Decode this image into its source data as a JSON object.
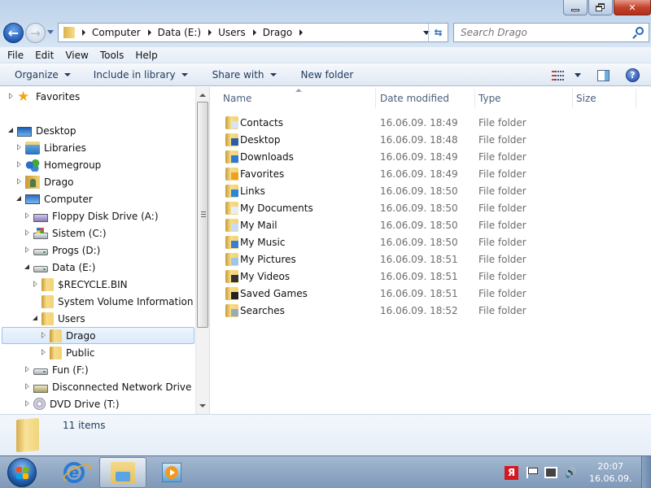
{
  "window": {
    "controls": {
      "minimize": "minimize",
      "restore": "restore",
      "close": "close"
    }
  },
  "nav": {
    "back_icon": "back-arrow-icon",
    "forward_icon": "forward-arrow-icon",
    "breadcrumbs": [
      "Computer",
      "Data (E:)",
      "Users",
      "Drago"
    ],
    "search_placeholder": "Search Drago"
  },
  "menubar": {
    "items": [
      "File",
      "Edit",
      "View",
      "Tools",
      "Help"
    ]
  },
  "toolbar": {
    "organize": "Organize",
    "include_in_library": "Include in library",
    "share_with": "Share with",
    "new_folder": "New folder",
    "help_glyph": "?"
  },
  "navpane": {
    "items": [
      {
        "label": "Favorites",
        "icon": "star-icon",
        "expander": "closed",
        "level": 0
      },
      {
        "label": "Desktop",
        "icon": "desktop-icon",
        "expander": "open",
        "level": 0
      },
      {
        "label": "Libraries",
        "icon": "libraries-icon",
        "expander": "closed",
        "level": 1
      },
      {
        "label": "Homegroup",
        "icon": "homegroup-icon",
        "expander": "closed",
        "level": 1
      },
      {
        "label": "Drago",
        "icon": "user-folder-icon",
        "expander": "closed",
        "level": 1
      },
      {
        "label": "Computer",
        "icon": "computer-icon",
        "expander": "open",
        "level": 1
      },
      {
        "label": "Floppy Disk Drive (A:)",
        "icon": "floppy-drive-icon",
        "expander": "closed",
        "level": 2
      },
      {
        "label": "Sistem (C:)",
        "icon": "system-drive-icon",
        "expander": "closed",
        "level": 2
      },
      {
        "label": "Progs (D:)",
        "icon": "drive-icon",
        "expander": "closed",
        "level": 2
      },
      {
        "label": "Data (E:)",
        "icon": "drive-icon",
        "expander": "open",
        "level": 2
      },
      {
        "label": "$RECYCLE.BIN",
        "icon": "folder-icon",
        "expander": "closed",
        "level": 3
      },
      {
        "label": "System Volume Information",
        "icon": "folder-icon",
        "expander": "none",
        "level": 3
      },
      {
        "label": "Users",
        "icon": "folder-icon",
        "expander": "open",
        "level": 3
      },
      {
        "label": "Drago",
        "icon": "folder-icon",
        "expander": "closed",
        "level": 4,
        "selected": true
      },
      {
        "label": "Public",
        "icon": "folder-icon",
        "expander": "closed",
        "level": 4
      },
      {
        "label": "Fun (F:)",
        "icon": "drive-icon",
        "expander": "closed",
        "level": 2
      },
      {
        "label": "Disconnected Network Drive (S:)",
        "icon": "network-drive-icon",
        "expander": "closed",
        "level": 2
      },
      {
        "label": "DVD Drive (T:)",
        "icon": "dvd-drive-icon",
        "expander": "closed",
        "level": 2
      }
    ]
  },
  "content": {
    "columns": [
      "Name",
      "Date modified",
      "Type",
      "Size"
    ],
    "sort_column": "Name",
    "rows": [
      {
        "name": "Contacts",
        "date": "16.06.09. 18:49",
        "type": "File folder",
        "size": "",
        "icon": "contacts-folder-icon"
      },
      {
        "name": "Desktop",
        "date": "16.06.09. 18:48",
        "type": "File folder",
        "size": "",
        "icon": "desktop-folder-icon"
      },
      {
        "name": "Downloads",
        "date": "16.06.09. 18:49",
        "type": "File folder",
        "size": "",
        "icon": "downloads-folder-icon"
      },
      {
        "name": "Favorites",
        "date": "16.06.09. 18:49",
        "type": "File folder",
        "size": "",
        "icon": "favorites-folder-icon"
      },
      {
        "name": "Links",
        "date": "16.06.09. 18:50",
        "type": "File folder",
        "size": "",
        "icon": "links-folder-icon"
      },
      {
        "name": "My Documents",
        "date": "16.06.09. 18:50",
        "type": "File folder",
        "size": "",
        "icon": "documents-folder-icon"
      },
      {
        "name": "My Mail",
        "date": "16.06.09. 18:50",
        "type": "File folder",
        "size": "",
        "icon": "mail-folder-icon"
      },
      {
        "name": "My Music",
        "date": "16.06.09. 18:50",
        "type": "File folder",
        "size": "",
        "icon": "music-folder-icon"
      },
      {
        "name": "My Pictures",
        "date": "16.06.09. 18:51",
        "type": "File folder",
        "size": "",
        "icon": "pictures-folder-icon"
      },
      {
        "name": "My Videos",
        "date": "16.06.09. 18:51",
        "type": "File folder",
        "size": "",
        "icon": "videos-folder-icon"
      },
      {
        "name": "Saved Games",
        "date": "16.06.09. 18:51",
        "type": "File folder",
        "size": "",
        "icon": "saved-games-folder-icon"
      },
      {
        "name": "Searches",
        "date": "16.06.09. 18:52",
        "type": "File folder",
        "size": "",
        "icon": "searches-folder-icon"
      }
    ]
  },
  "details": {
    "item_count": "11 items"
  },
  "taskbar": {
    "pinned": [
      "start-orb",
      "internet-explorer",
      "windows-explorer",
      "windows-media-player"
    ],
    "active": "windows-explorer",
    "tray_icons": [
      "avira-icon",
      "action-center-flag-icon",
      "network-icon",
      "volume-icon"
    ],
    "avira_glyph": "Я",
    "volume_glyph": "🔊",
    "clock_time": "20:07",
    "clock_date": "16.06.09."
  },
  "colors": {
    "accent": "#1e395b",
    "selection_bg": "#dbeafb",
    "selection_border": "#9ac4ee",
    "close_button": "#c2432d",
    "secondary_text": "#6d6d6d"
  }
}
